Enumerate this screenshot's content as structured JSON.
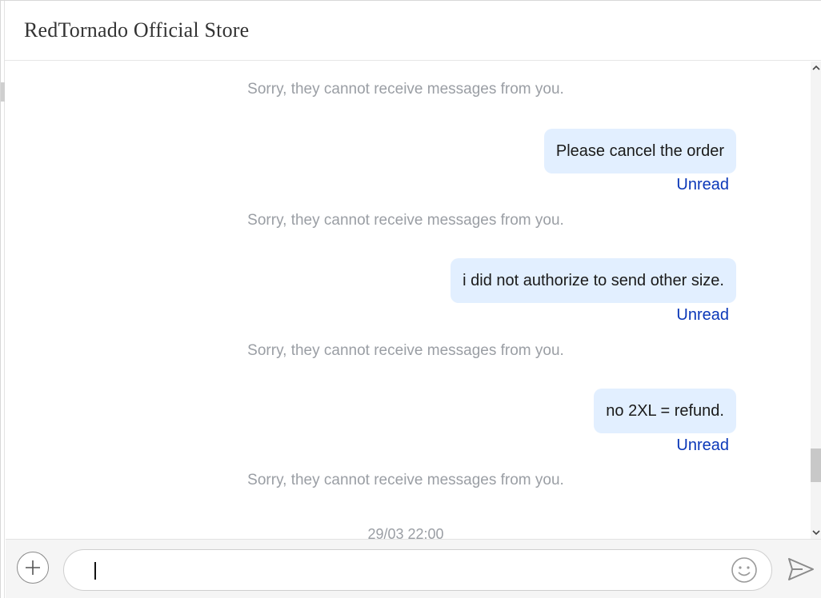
{
  "header": {
    "title": "RedTornado Official Store"
  },
  "messages": {
    "system_notes": [
      "Sorry, they cannot receive messages from you.",
      "Sorry, they cannot receive messages from you.",
      "Sorry, they cannot receive messages from you.",
      "Sorry, they cannot receive messages from you."
    ],
    "sent": [
      {
        "text": "Please cancel the order",
        "status": "Unread"
      },
      {
        "text": "i did not authorize to send other size.",
        "status": "Unread"
      },
      {
        "text": "no 2XL = refund.",
        "status": "Unread"
      }
    ],
    "timestamp": "29/03 22:00"
  },
  "composer": {
    "input_value": "",
    "placeholder": "",
    "attach_icon": "plus-icon",
    "emoji_icon": "smiley-icon",
    "send_icon": "send-arrow-icon"
  },
  "colors": {
    "bubble_bg": "#e2efff",
    "unread_text": "#0a37b8",
    "system_text": "#9a9ea4"
  }
}
